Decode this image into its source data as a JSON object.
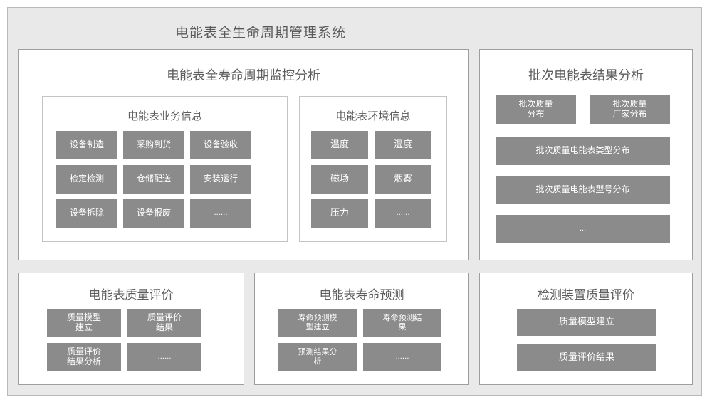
{
  "app": {
    "title": "电能表全生命周期管理系统"
  },
  "panels": {
    "monitor": {
      "title": "电能表全寿命周期监控分析",
      "subpanels": {
        "business": {
          "title": "电能表业务信息",
          "tiles": [
            "设备制造",
            "采购到货",
            "设备验收",
            "检定检测",
            "仓储配送",
            "安装运行",
            "设备拆除",
            "设备报废",
            "......"
          ]
        },
        "environment": {
          "title": "电能表环境信息",
          "tiles": [
            "温度",
            "湿度",
            "磁场",
            "烟雾",
            "压力",
            "......"
          ]
        }
      }
    },
    "batch": {
      "title": "批次电能表结果分析",
      "tiles": [
        "批次质量\n分布",
        "批次质量\n厂家分布",
        "批次质量电能表类型分布",
        "批次质量电能表型号分布",
        "..."
      ]
    },
    "quality": {
      "title": "电能表质量评价",
      "tiles": [
        "质量模型\n建立",
        "质量评价\n结果",
        "质量评价\n结果分析",
        "......"
      ]
    },
    "life": {
      "title": "电能表寿命预测",
      "tiles": [
        "寿命预测模\n型建立",
        "寿命预测结\n果",
        "预测结果分\n析",
        "......"
      ]
    },
    "device": {
      "title": "检测装置质量评价",
      "tiles": [
        "质量模型建立",
        "质量评价结果"
      ]
    }
  },
  "colors": {
    "frame_background": "#e9e9e9",
    "panel_background": "#ffffff",
    "tile_background": "#8b8b8b",
    "tile_text": "#ffffff",
    "title_text": "#5e5e5e",
    "border": "#9e9e9e"
  }
}
